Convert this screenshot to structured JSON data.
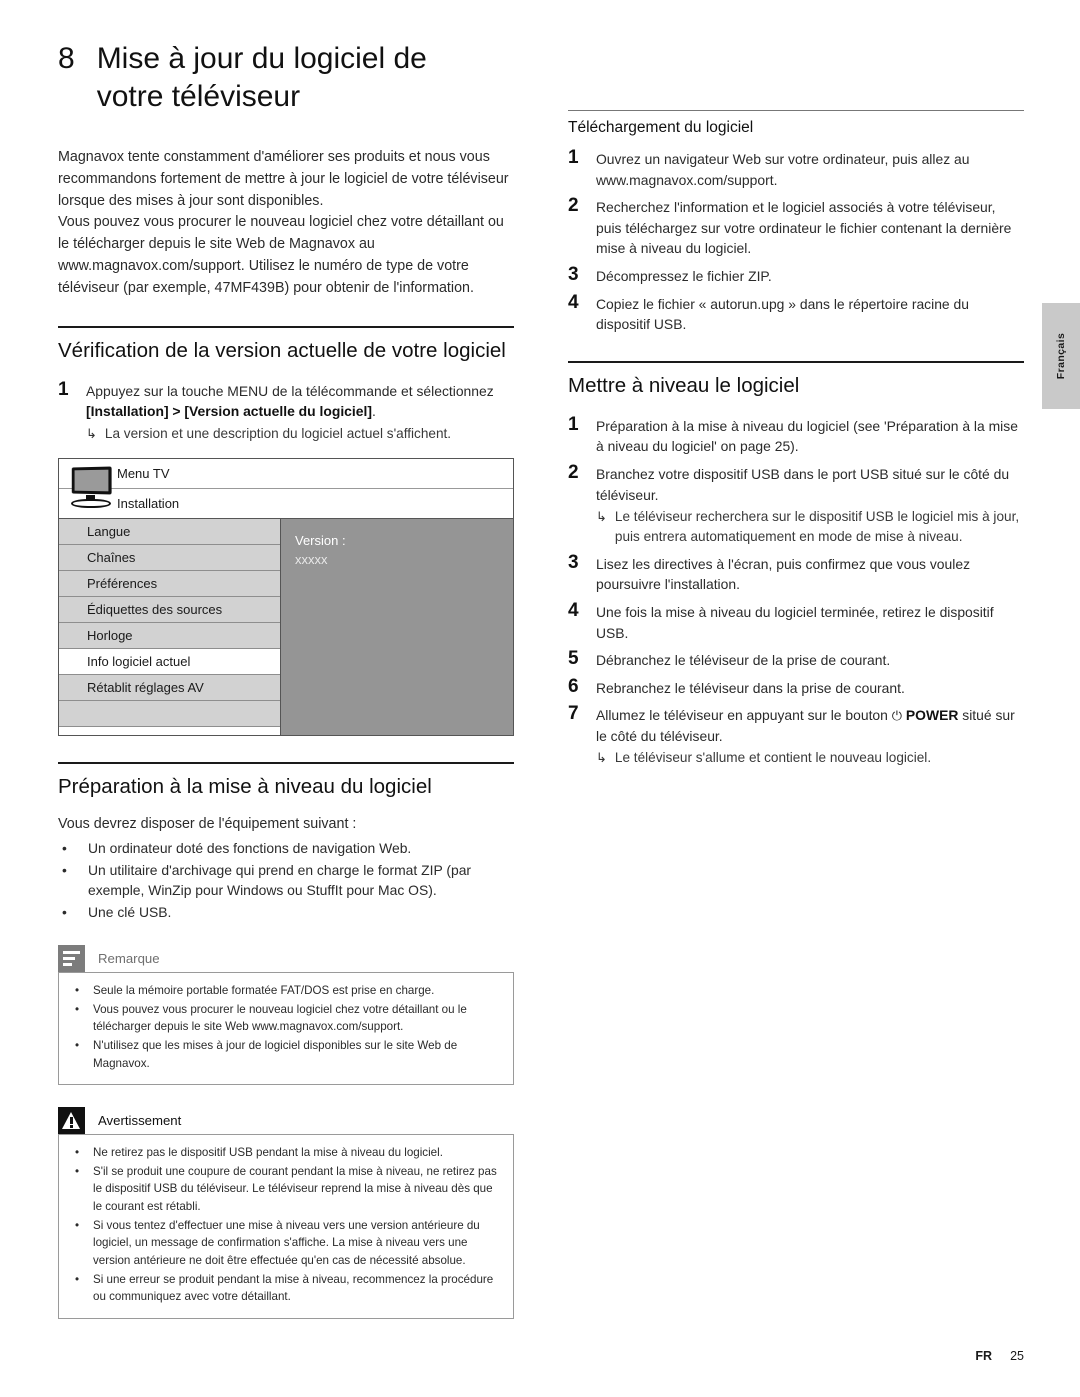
{
  "chapter": {
    "number": "8",
    "title": "Mise à jour du logiciel de votre téléviseur"
  },
  "intro": {
    "p1": "Magnavox tente constamment d'améliorer ses produits et nous vous recommandons fortement de mettre à jour le logiciel de votre téléviseur lorsque des mises à jour sont disponibles.",
    "p2": "Vous pouvez vous procurer le nouveau logiciel chez votre détaillant ou le télécharger depuis le site Web de Magnavox au www.magnavox.com/support. Utilisez le numéro de type de votre téléviseur (par exemple, 47MF439B) pour obtenir de l'information."
  },
  "section_verification": {
    "heading": "Vérification de la version actuelle de votre logiciel",
    "step1_num": "1",
    "step1_text_a": "Appuyez sur la touche MENU de la télécommande et sélectionnez ",
    "step1_text_b": "[Installation] > [Version actuelle du logiciel]",
    "step1_text_c": ".",
    "step1_sub": "La version et une description du logiciel actuel s'affichent.",
    "arrow": "↳"
  },
  "tv_menu": {
    "header1": "Menu TV",
    "header2": "Installation",
    "items": [
      {
        "label": "Langue",
        "selected": false
      },
      {
        "label": "Chaînes",
        "selected": false
      },
      {
        "label": "Préférences",
        "selected": false
      },
      {
        "label": "Édiquettes des sources",
        "selected": false
      },
      {
        "label": "Horloge",
        "selected": false
      },
      {
        "label": "Info logiciel actuel",
        "selected": true
      },
      {
        "label": "Rétablit réglages AV",
        "selected": false
      },
      {
        "label": "",
        "selected": false
      }
    ],
    "version_label": "Version :",
    "version_value": "xxxxx"
  },
  "section_preparation": {
    "heading": "Préparation à la mise à niveau du logiciel",
    "lead": "Vous devrez disposer de l'équipement suivant :",
    "bullet_char": "•",
    "bullets": [
      "Un ordinateur doté des fonctions de navigation Web.",
      "Un utilitaire d'archivage qui prend en charge le format ZIP (par exemple, WinZip pour Windows ou StuffIt pour Mac OS).",
      "Une clé USB."
    ]
  },
  "note": {
    "title": "Remarque",
    "icon": "note-lines-icon",
    "bullet_char": "•",
    "items": [
      "Seule la mémoire portable formatée FAT/DOS est prise en charge.",
      "Vous pouvez vous procurer le nouveau logiciel chez votre détaillant ou le télécharger depuis le site Web www.magnavox.com/support.",
      "N'utilisez que les mises à jour de logiciel disponibles sur le site Web de Magnavox."
    ]
  },
  "warning": {
    "title": "Avertissement",
    "icon": "warning-triangle-icon",
    "bullet_char": "•",
    "items": [
      "Ne retirez pas le dispositif USB pendant la mise à niveau du logiciel.",
      "S'il se produit une coupure de courant pendant la mise à niveau, ne retirez pas le dispositif USB du téléviseur. Le téléviseur reprend la mise à niveau dès que le courant est rétabli.",
      "Si vous tentez d'effectuer une mise à niveau vers une version antérieure du logiciel, un message de confirmation s'affiche. La mise à niveau vers une version antérieure ne doit être effectuée qu'en cas de nécessité absolue.",
      "Si une erreur se produit pendant la mise à niveau, recommencez la procédure ou communiquez avec votre détaillant."
    ]
  },
  "section_download": {
    "heading": "Téléchargement du logiciel",
    "steps": [
      {
        "num": "1",
        "text": "Ouvrez un navigateur Web sur votre ordinateur, puis allez au www.magnavox.com/support."
      },
      {
        "num": "2",
        "text": "Recherchez l'information et le logiciel associés à votre téléviseur, puis téléchargez sur votre ordinateur le fichier contenant la dernière mise à niveau du logiciel."
      },
      {
        "num": "3",
        "text": "Décompressez le fichier ZIP."
      },
      {
        "num": "4",
        "text": "Copiez le fichier « autorun.upg » dans le répertoire racine du dispositif USB."
      }
    ]
  },
  "section_upgrade": {
    "heading": "Mettre à niveau le logiciel",
    "arrow": "↳",
    "steps": [
      {
        "num": "1",
        "text": "Préparation à la mise à niveau du logiciel (see 'Préparation à la mise à niveau du logiciel' on page 25).",
        "sub": ""
      },
      {
        "num": "2",
        "text": "Branchez votre dispositif USB dans le port USB situé sur le côté du téléviseur.",
        "sub": "Le téléviseur recherchera sur le dispositif USB le logiciel mis à jour, puis entrera automatiquement en mode de mise à niveau."
      },
      {
        "num": "3",
        "text": "Lisez les directives à l'écran, puis confirmez que vous voulez poursuivre l'installation.",
        "sub": ""
      },
      {
        "num": "4",
        "text": "Une fois la mise à niveau du logiciel terminée, retirez le dispositif USB.",
        "sub": ""
      },
      {
        "num": "5",
        "text": "Débranchez le téléviseur de la prise de courant.",
        "sub": ""
      },
      {
        "num": "6",
        "text": "Rebranchez le téléviseur dans la prise de courant.",
        "sub": ""
      }
    ],
    "step7": {
      "num": "7",
      "text_a": "Allumez le téléviseur en appuyant sur le bouton ",
      "power_glyph": "⏻",
      "power_label": "POWER",
      "text_b": " situé sur le côté du téléviseur.",
      "sub": "Le téléviseur s'allume et contient le nouveau logiciel."
    }
  },
  "side_tab": {
    "label": "Français"
  },
  "footer": {
    "lang": "FR",
    "page": "25"
  },
  "colors": {
    "text": "#2b2b2b",
    "heading": "#111111",
    "rule": "#1a1a1a",
    "menu_row": "#d2d2d2",
    "menu_panel": "#959595",
    "note_icon_bg": "#7c7c7c",
    "warn_icon_bg": "#111111",
    "side_tab_bg": "#c9c9c9"
  }
}
